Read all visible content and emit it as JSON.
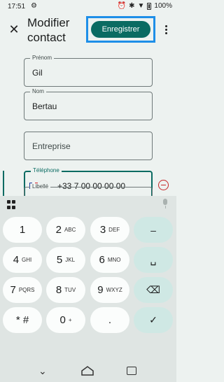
{
  "status_bar": {
    "time": "17:51",
    "battery": "100%"
  },
  "app_bar": {
    "title": "Modifier contact",
    "save_label": "Enregistrer"
  },
  "form": {
    "first_name": {
      "label": "Prénom",
      "value": "Gil"
    },
    "last_name": {
      "label": "Nom",
      "value": "Bertau"
    },
    "company": {
      "placeholder": "Entreprise"
    },
    "phone": {
      "label": "Téléphone",
      "value": "+33 7 00 00 00 00",
      "country": "FR"
    },
    "phone_type": {
      "label": "Libellé"
    }
  },
  "keyboard": {
    "keys": [
      {
        "num": "1",
        "sub": ""
      },
      {
        "num": "2",
        "sub": "ABC"
      },
      {
        "num": "3",
        "sub": "DEF"
      },
      {
        "num": "4",
        "sub": "GHI"
      },
      {
        "num": "5",
        "sub": "JKL"
      },
      {
        "num": "6",
        "sub": "MNO"
      },
      {
        "num": "7",
        "sub": "PQRS"
      },
      {
        "num": "8",
        "sub": "TUV"
      },
      {
        "num": "9",
        "sub": "WXYZ"
      },
      {
        "num": "* #",
        "sub": ""
      },
      {
        "num": "0",
        "sub": "+"
      },
      {
        "num": ".",
        "sub": ""
      }
    ],
    "fn_keys": {
      "minus": "–",
      "space": "␣",
      "backspace": "⌫",
      "enter": "✓"
    }
  },
  "colors": {
    "accent": "#0a6b62",
    "highlight": "#1e8fe8",
    "danger": "#c62828",
    "background": "#edf2f0"
  }
}
